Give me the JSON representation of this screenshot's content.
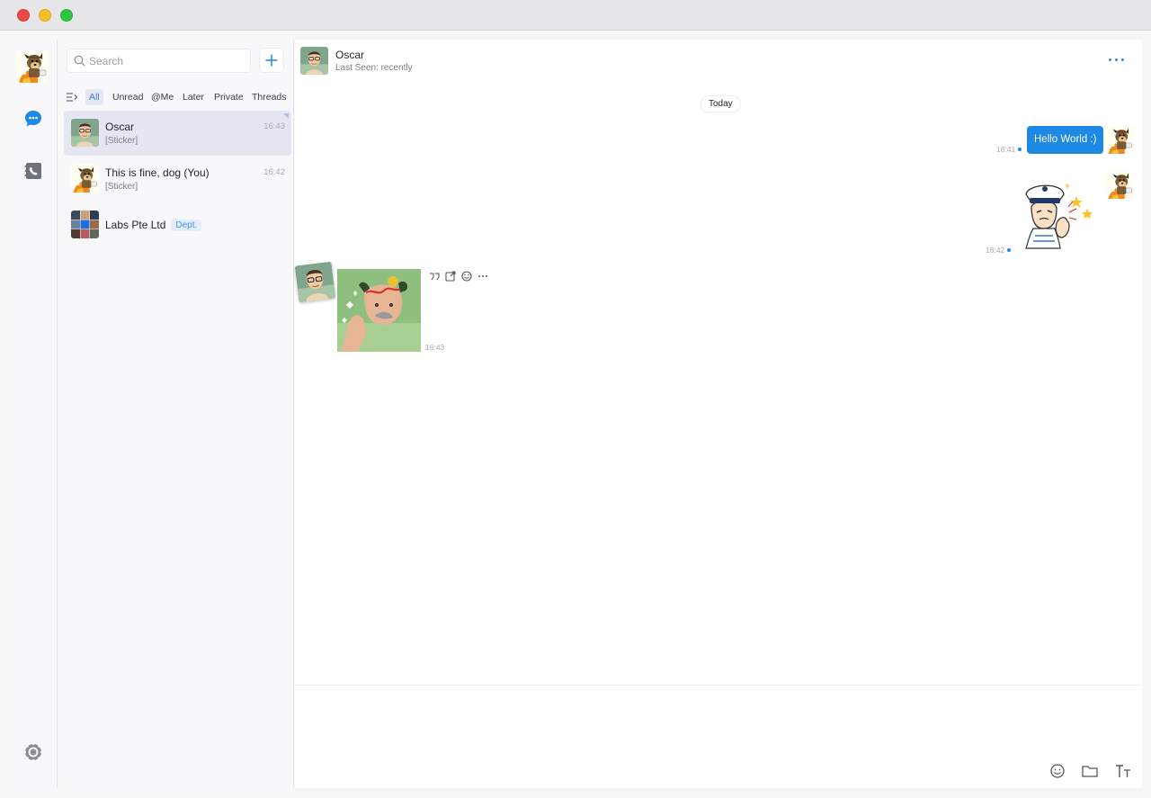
{
  "window": {
    "buttons": [
      "close",
      "minimize",
      "zoom"
    ]
  },
  "rail": {
    "items": [
      {
        "icon": "user-avatar-dog",
        "label": "Profile"
      },
      {
        "icon": "chat-bubble-icon",
        "label": "Chats",
        "active": true
      },
      {
        "icon": "contacts-icon",
        "label": "Contacts"
      }
    ],
    "settings_icon": "settings-gear-icon"
  },
  "sidebar": {
    "search": {
      "placeholder": "Search",
      "value": ""
    },
    "new_button_icon": "plus-icon",
    "filters": [
      "All",
      "Unread",
      "@Me",
      "Later",
      "Private",
      "Threads"
    ],
    "active_filter": "All",
    "conversations": [
      {
        "name": "Oscar",
        "preview": "[Sticker]",
        "time": "16:43",
        "selected": true
      },
      {
        "name": "This is fine, dog (You)",
        "preview": "[Sticker]",
        "time": "16:42",
        "selected": false
      },
      {
        "name": "Labs Pte Ltd",
        "badge": "Dept.",
        "preview": "",
        "time": "",
        "selected": false
      }
    ]
  },
  "chat": {
    "title": "Oscar",
    "status": "Last Seen: recently",
    "date_divider": "Today",
    "messages": [
      {
        "direction": "out",
        "type": "text",
        "text": "Hello World :)",
        "time": "16:41"
      },
      {
        "direction": "out",
        "type": "sticker",
        "sticker": "sailor-thumbs-up",
        "time": "16:42"
      },
      {
        "direction": "in",
        "type": "sticker",
        "sticker": "baby-with-crown",
        "time": "16:43"
      }
    ],
    "message_actions": [
      "reply-quote-icon",
      "forward-icon",
      "react-icon",
      "more-icon"
    ],
    "composer_tools": [
      "emoji-icon",
      "folder-icon",
      "text-format-icon"
    ]
  },
  "colors": {
    "accent": "#1e88e5",
    "selected_row": "#e5e6f2"
  }
}
